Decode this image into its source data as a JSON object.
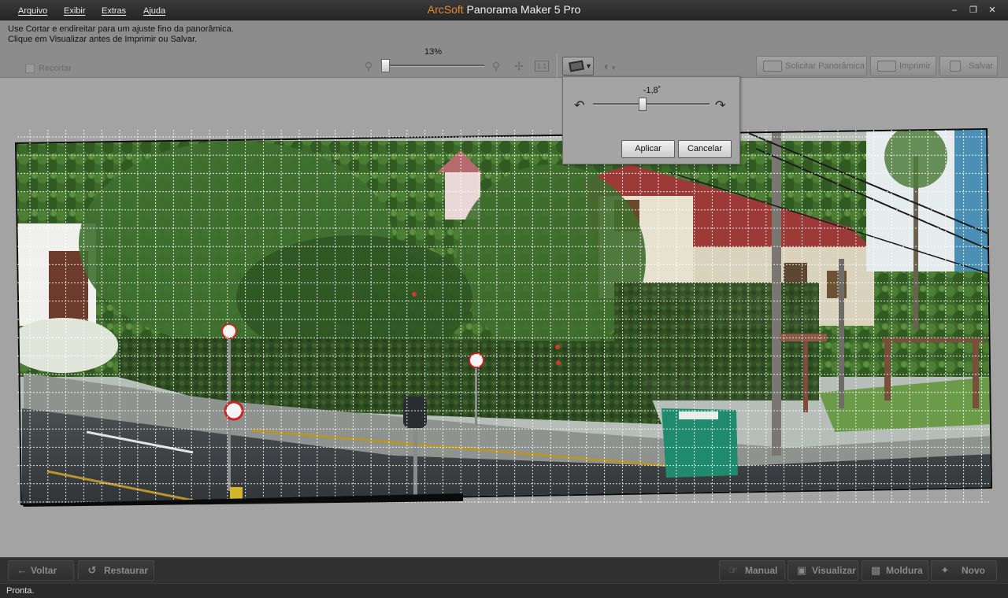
{
  "menu": {
    "items": [
      "Arquivo",
      "Exibir",
      "Extras",
      "Ajuda"
    ]
  },
  "title": {
    "brand": "ArcSoft",
    "product": " Panorama Maker 5 Pro"
  },
  "window_controls": {
    "minimize": "–",
    "restore": "❐",
    "close": "✕"
  },
  "instructions": {
    "line1": "Use Cortar e endireitar para um ajuste fino da panorâmica.",
    "line2": "Clique em Visualizar antes de Imprimir ou Salvar."
  },
  "toolbar": {
    "crop_label": "Recortar",
    "crop_checked": false,
    "zoom_label": "13%",
    "zoom_percent": 13,
    "actions": [
      {
        "label": "Solicitar Panorâmica",
        "icon": "scanner-icon"
      },
      {
        "label": "Imprimir",
        "icon": "printer-icon"
      },
      {
        "label": "Salvar",
        "icon": "save-icon"
      }
    ]
  },
  "straighten_panel": {
    "angle_label": "-1,8˚",
    "angle_degrees": -1.8,
    "apply_label": "Aplicar",
    "cancel_label": "Cancelar"
  },
  "bottom_nav": {
    "back_label": "Voltar",
    "restore_label": "Restaurar",
    "manual_label": "Manual",
    "preview_label": "Visualizar",
    "frame_label": "Moldura",
    "new_label": "Novo"
  },
  "status": {
    "text": "Pronta."
  }
}
